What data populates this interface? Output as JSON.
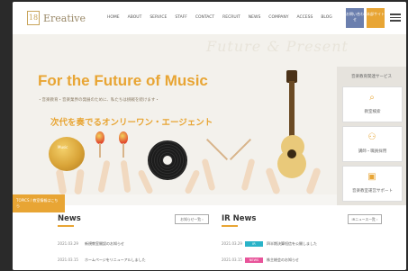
{
  "header": {
    "logo_mark": "18",
    "logo_text": "Ereative",
    "nav": [
      "HOME",
      "ABOUT",
      "SERVICE",
      "STAFF",
      "CONTACT",
      "RECRUIT",
      "NEWS",
      "COMPANY",
      "ACCESS",
      "BLOG"
    ],
    "contact_label": "お問い合わせ",
    "hq_label": "本部サイト"
  },
  "hero": {
    "bg_script": "Future & Present",
    "title": "For the Future of Music",
    "subtitle": "・音楽教育・音楽業界の発展のために、私たちは挑戦を続けます・",
    "catch": "次代を奏でるオンリーワン・エージェント",
    "cymbal_label": "Music"
  },
  "sidebar": {
    "title": "音楽教育関連サービス",
    "cards": [
      {
        "icon": "search-icon",
        "glyph": "⌕",
        "label": "教室検索"
      },
      {
        "icon": "people-icon",
        "glyph": "⚇",
        "label": "講師・職員採用"
      },
      {
        "icon": "building-icon",
        "glyph": "▣",
        "label": "音楽教室運営サポート"
      }
    ]
  },
  "corner_banner": "TOPICS / 教室情報はこちら",
  "news": {
    "heading": "News",
    "more": "お知らせ一覧 ›",
    "rows": [
      {
        "date": "2021.03.29",
        "text": "新規教室開設のお知らせ"
      },
      {
        "date": "2021.03.15",
        "text": "ホームページをリニューアルしました"
      }
    ]
  },
  "ir_news": {
    "heading": "IR News",
    "more": "IRニュース一覧 ›",
    "rows": [
      {
        "date": "2021.03.29",
        "tag": "IR",
        "tag_color": "#2ab3c8",
        "text": "四半期決算短信を公開しました"
      },
      {
        "date": "2021.03.15",
        "tag": "NEWS",
        "tag_color": "#e8549a",
        "text": "株主総会のお知らせ"
      }
    ]
  },
  "colors": {
    "accent": "#e8a534",
    "nav_blue": "#6b7fae"
  }
}
